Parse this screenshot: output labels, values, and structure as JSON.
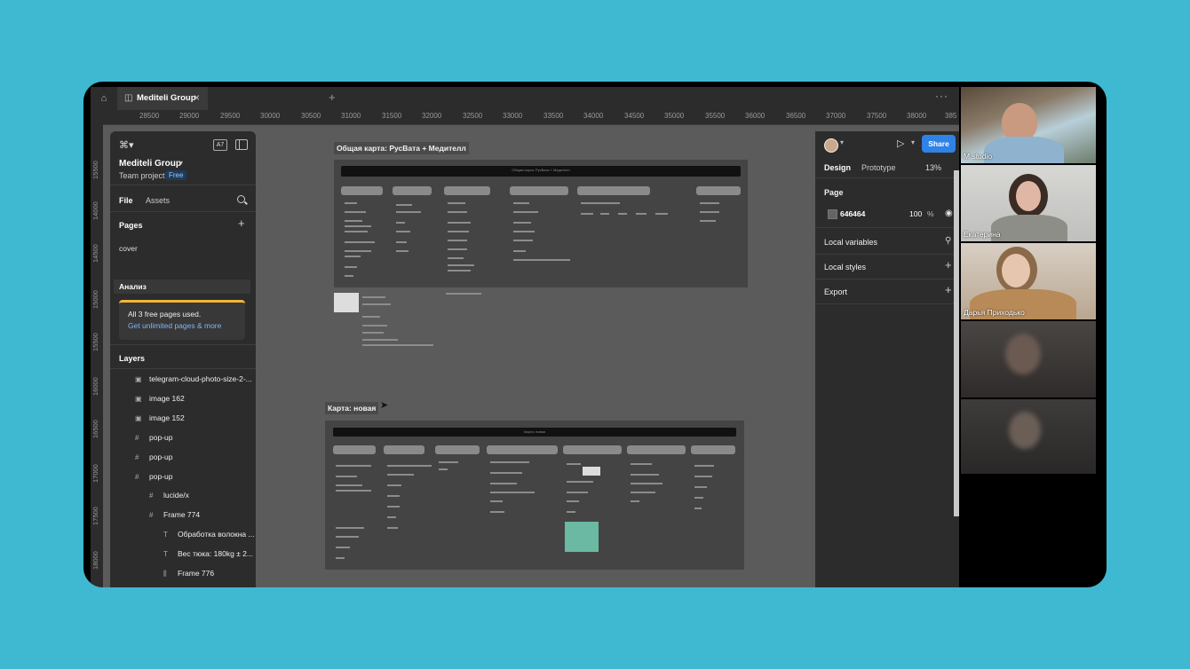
{
  "tab": {
    "title": "Mediteli Group"
  },
  "ruler": {
    "h": [
      "28500",
      "29000",
      "29500",
      "30000",
      "30500",
      "31000",
      "31500",
      "32000",
      "32500",
      "33000",
      "33500",
      "34000",
      "34500",
      "35000",
      "35500",
      "36000",
      "36500",
      "37000",
      "37500",
      "38000",
      "385"
    ],
    "v": [
      "15500",
      "14000",
      "14500",
      "15000",
      "15500",
      "16000",
      "16500",
      "17000",
      "17500",
      "18000"
    ]
  },
  "left_panel": {
    "project_name": "Mediteli Group",
    "project_type": "Team project",
    "plan_badge": "Free",
    "tabs": [
      "File",
      "Assets"
    ],
    "pages_header": "Pages",
    "pages": [
      "cover"
    ],
    "selected_page": "Анализ",
    "promo_line1": "All 3 free pages used.",
    "promo_line2": "Get unlimited pages & more",
    "layers_header": "Layers",
    "layers": [
      {
        "label": "telegram-cloud-photo-size-2-...",
        "icon": "image-icon"
      },
      {
        "label": "image 162",
        "icon": "image-icon"
      },
      {
        "label": "image 152",
        "icon": "image-icon"
      },
      {
        "label": "pop-up",
        "icon": "frame-icon"
      },
      {
        "label": "pop-up",
        "icon": "frame-icon"
      },
      {
        "label": "pop-up",
        "icon": "frame-icon"
      },
      {
        "label": "lucide/x",
        "icon": "frame-icon"
      },
      {
        "label": "Frame 774",
        "icon": "frame-icon"
      },
      {
        "label": "Обработка волокна ...",
        "icon": "text-icon"
      },
      {
        "label": "Вес тюка: 180kg ± 2...",
        "icon": "text-icon"
      },
      {
        "label": "Frame 776",
        "icon": "autolayout-icon"
      }
    ]
  },
  "canvas": {
    "frame1_label": "Общая карта: РусВата + Медителл",
    "frame1_bar": "Общая карта: РусВата + Медителл",
    "frame2_label": "Карта: новая",
    "frame2_bar": "Карта: новая"
  },
  "right_panel": {
    "share_label": "Share",
    "tabs": [
      "Design",
      "Prototype"
    ],
    "zoom": "13%",
    "page_header": "Page",
    "bg_hex": "646464",
    "bg_opacity": "100",
    "bg_opacity_unit": "%",
    "local_variables": "Local variables",
    "local_styles": "Local styles",
    "export": "Export"
  },
  "participants": [
    {
      "name": "M studio"
    },
    {
      "name": "Екатерина"
    },
    {
      "name": "Дарья Приходько"
    },
    {
      "name": ""
    },
    {
      "name": ""
    }
  ],
  "colors": {
    "background": "#3fb8d1",
    "share": "#2f82e6",
    "canvas": "#5b5b5b",
    "panel": "#2c2c2c"
  }
}
